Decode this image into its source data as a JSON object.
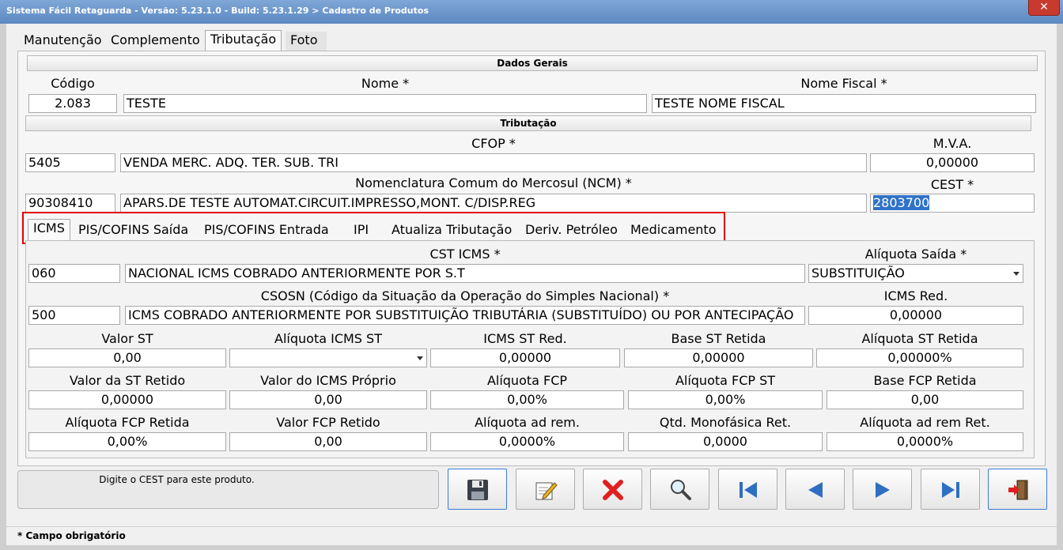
{
  "window": {
    "title": "Sistema Fácil Retaguarda - Versão: 5.23.1.0  - Build: 5.23.1.29 > Cadastro de Produtos",
    "close_label": "✕"
  },
  "tabs": [
    {
      "label": "Manutenção"
    },
    {
      "label": "Complemento"
    },
    {
      "label": "Tributação",
      "active": true
    },
    {
      "label": "Foto"
    }
  ],
  "dados_gerais": {
    "section": "Dados Gerais",
    "codigo_label": "Código",
    "codigo": "2.083",
    "nome_label": "Nome *",
    "nome": "TESTE",
    "nome_fiscal_label": "Nome Fiscal *",
    "nome_fiscal": "TESTE NOME FISCAL"
  },
  "tributacao": {
    "section": "Tributação",
    "cfop_label": "CFOP *",
    "cfop_code": "5405",
    "cfop_desc": "VENDA MERC. ADQ. TER. SUB. TRI",
    "mva_label": "M.V.A.",
    "mva": "0,00000",
    "ncm_label": "Nomenclatura Comum do Mercosul (NCM) *",
    "ncm_code": "90308410",
    "ncm_desc": "APARS.DE TESTE AUTOMAT.CIRCUIT.IMPRESSO,MONT. C/DISP.REG",
    "cest_label": "CEST *",
    "cest": "2803700"
  },
  "subtabs": [
    {
      "label": "ICMS",
      "active": true
    },
    {
      "label": "PIS/COFINS Saída"
    },
    {
      "label": "PIS/COFINS Entrada"
    },
    {
      "label": "IPI"
    },
    {
      "label": "Atualiza Tributação"
    },
    {
      "label": "Deriv. Petróleo"
    },
    {
      "label": "Medicamento"
    }
  ],
  "icms": {
    "cst_label": "CST ICMS *",
    "cst_code": "060",
    "cst_desc": "NACIONAL ICMS COBRADO ANTERIORMENTE POR S.T",
    "aliquota_saida_label": "Alíquota Saída *",
    "aliquota_saida": "SUBSTITUIÇÃO",
    "csosn_label": "CSOSN (Código da Situação da Operação do Simples Nacional) *",
    "csosn_code": "500",
    "csosn_desc": "ICMS COBRADO ANTERIORMENTE POR SUBSTITUIÇÃO TRIBUTÁRIA (SUBSTITUÍDO) OU POR ANTECIPAÇÃO",
    "icms_red_label": "ICMS Red.",
    "icms_red": "0,00000",
    "row1": [
      {
        "label": "Valor ST",
        "value": "0,00"
      },
      {
        "label": "Alíquota ICMS ST",
        "value": ""
      },
      {
        "label": "ICMS ST Red.",
        "value": "0,00000"
      },
      {
        "label": "Base ST Retida",
        "value": "0,00000"
      },
      {
        "label": "Alíquota ST Retida",
        "value": "0,00000%"
      }
    ],
    "row2": [
      {
        "label": "Valor da ST Retido",
        "value": "0,00000"
      },
      {
        "label": "Valor do ICMS Próprio",
        "value": "0,00"
      },
      {
        "label": "Alíquota FCP",
        "value": "0,00%"
      },
      {
        "label": "Alíquota FCP ST",
        "value": "0,00%"
      },
      {
        "label": "Base FCP Retida",
        "value": "0,00"
      }
    ],
    "row3": [
      {
        "label": "Alíquota FCP Retida",
        "value": "0,00%"
      },
      {
        "label": "Valor FCP Retido",
        "value": "0,00"
      },
      {
        "label": "Alíquota ad rem.",
        "value": "0,0000%"
      },
      {
        "label": "Qtd. Monofásica Ret.",
        "value": "0,0000"
      },
      {
        "label": "Alíquota ad rem Ret.",
        "value": "0,0000%"
      }
    ]
  },
  "message": "Digite o CEST para este produto.",
  "status": "*  Campo obrigatório",
  "buttons": [
    {
      "icon": "floppy-disk-icon",
      "name": "save-button"
    },
    {
      "icon": "pencil-edit-icon",
      "name": "edit-button"
    },
    {
      "icon": "red-x-icon",
      "name": "cancel-button"
    },
    {
      "icon": "magnifier-icon",
      "name": "search-button"
    },
    {
      "icon": "first-record-icon",
      "name": "first-button"
    },
    {
      "icon": "previous-record-icon",
      "name": "previous-button"
    },
    {
      "icon": "next-record-icon",
      "name": "next-button"
    },
    {
      "icon": "last-record-icon",
      "name": "last-button"
    },
    {
      "icon": "exit-door-icon",
      "name": "exit-button"
    }
  ],
  "colors": {
    "titlebar": "#5c89c2",
    "close": "#c83a2e",
    "highlight": "#e00000",
    "selection": "#3072c8",
    "nav_blue": "#2f6fc2"
  }
}
